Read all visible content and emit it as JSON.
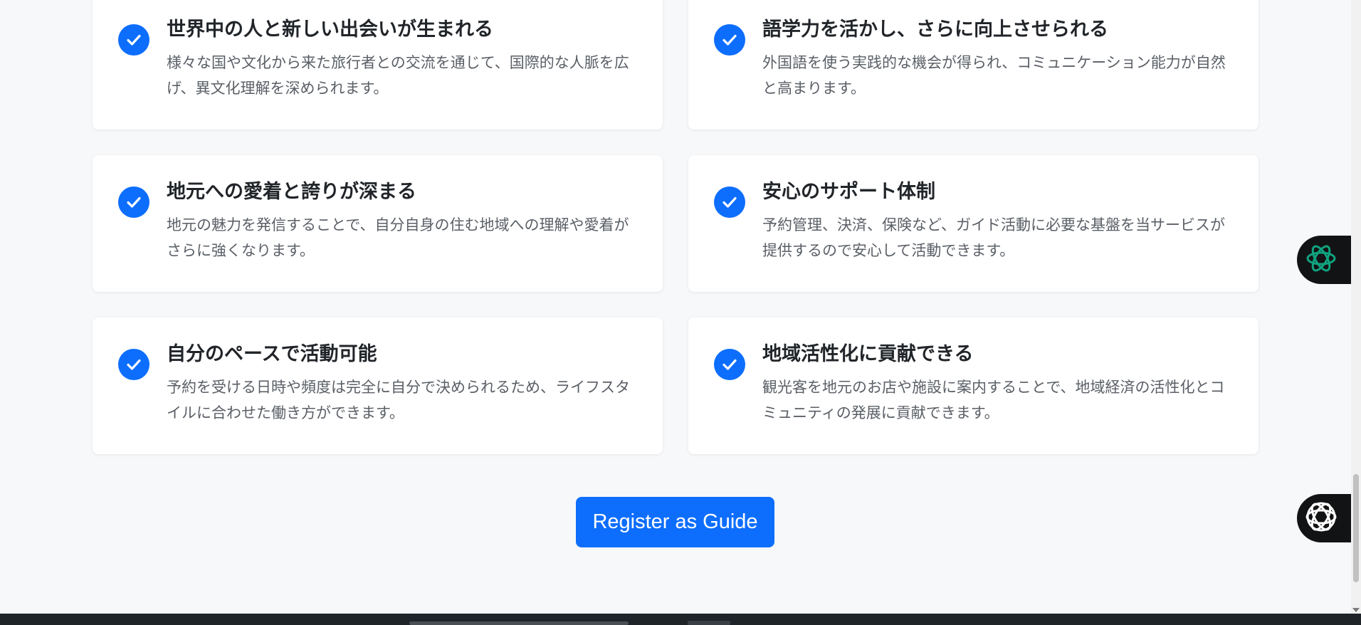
{
  "benefits": [
    {
      "title": "世界中の人と新しい出会いが生まれる",
      "description": "様々な国や文化から来た旅行者との交流を通じて、国際的な人脈を広げ、異文化理解を深められます。"
    },
    {
      "title": "語学力を活かし、さらに向上させられる",
      "description": "外国語を使う実践的な機会が得られ、コミュニケーション能力が自然と高まります。"
    },
    {
      "title": "地元への愛着と誇りが深まる",
      "description": "地元の魅力を発信することで、自分自身の住む地域への理解や愛着がさらに強くなります。"
    },
    {
      "title": "安心のサポート体制",
      "description": "予約管理、決済、保険など、ガイド活動に必要な基盤を当サービスが提供するので安心して活動できます。"
    },
    {
      "title": "自分のペースで活動可能",
      "description": "予約を受ける日時や頻度は完全に自分で決められるため、ライフスタイルに合わせた働き方ができます。"
    },
    {
      "title": "地域活性化に貢献できる",
      "description": "観光客を地元のお店や施設に案内することで、地域経済の活性化とコミュニティの発展に貢献できます。"
    }
  ],
  "cta": {
    "label": "Register as Guide"
  },
  "colors": {
    "accent": "#0d6efd",
    "background": "#f7f8fa",
    "card": "#ffffff",
    "floater_icon_green": "#10a37f",
    "floater_icon_white": "#ffffff"
  },
  "icons": {
    "check": "check-circle-icon",
    "floater_top": "chatgpt-logo-icon",
    "floater_bottom": "assistant-logo-icon"
  }
}
